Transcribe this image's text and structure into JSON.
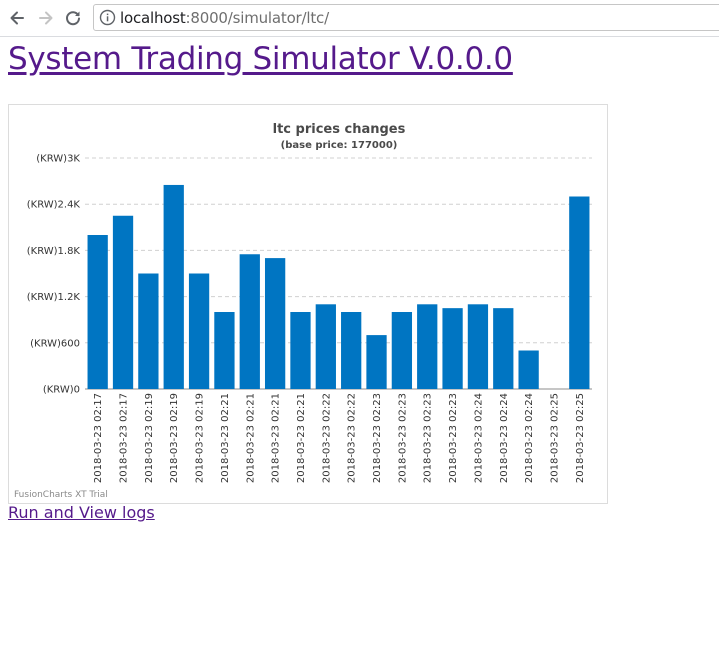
{
  "browser": {
    "url_host": "localhost",
    "url_path": ":8000/simulator/ltc/",
    "icons": [
      "back-arrow-icon",
      "forward-arrow-icon",
      "reload-icon",
      "info-icon"
    ]
  },
  "page": {
    "title": "System Trading Simulator V.0.0.0",
    "run_link": "Run and View logs"
  },
  "chart_data": {
    "type": "bar",
    "title": "ltc prices changes",
    "subtitle": "(base price: 177000)",
    "ylim": [
      0,
      3000
    ],
    "y_ticks": [
      {
        "value": 0,
        "label": "(KRW)0"
      },
      {
        "value": 600,
        "label": "(KRW)600"
      },
      {
        "value": 1200,
        "label": "(KRW)1.2K"
      },
      {
        "value": 1800,
        "label": "(KRW)1.8K"
      },
      {
        "value": 2400,
        "label": "(KRW)2.4K"
      },
      {
        "value": 3000,
        "label": "(KRW)3K"
      }
    ],
    "grid": true,
    "bar_color": "#0075c2",
    "categories": [
      "2018-03-23 02:17",
      "2018-03-23 02:17",
      "2018-03-23 02:19",
      "2018-03-23 02:19",
      "2018-03-23 02:19",
      "2018-03-23 02:21",
      "2018-03-23 02:21",
      "2018-03-23 02:21",
      "2018-03-23 02:21",
      "2018-03-23 02:22",
      "2018-03-23 02:22",
      "2018-03-23 02:23",
      "2018-03-23 02:23",
      "2018-03-23 02:23",
      "2018-03-23 02:23",
      "2018-03-23 02:24",
      "2018-03-23 02:24",
      "2018-03-23 02:24",
      "2018-03-23 02:25",
      "2018-03-23 02:25"
    ],
    "values": [
      2000,
      2250,
      1500,
      2650,
      1500,
      1000,
      1750,
      1700,
      1000,
      1100,
      1000,
      700,
      1000,
      1100,
      1050,
      1100,
      1050,
      500,
      0,
      2500
    ],
    "watermark": "FusionCharts XT Trial"
  }
}
